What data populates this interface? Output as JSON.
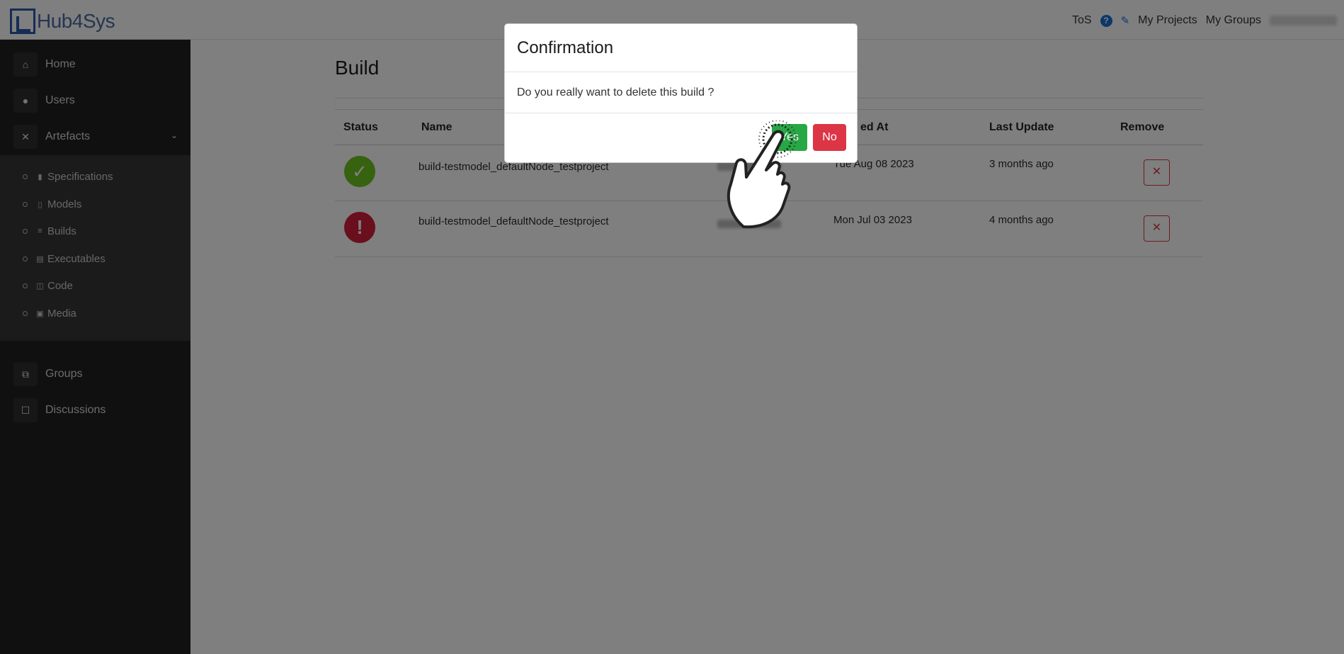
{
  "brand": {
    "name": "Hub4Sys"
  },
  "topnav": {
    "tos": "ToS",
    "help_icon": "help-icon",
    "feedback_icon": "feedback-icon",
    "my_projects": "My Projects",
    "my_groups": "My Groups"
  },
  "sidebar": {
    "items": [
      {
        "label": "Home",
        "icon": "home-icon"
      },
      {
        "label": "Users",
        "icon": "user-icon"
      },
      {
        "label": "Artefacts",
        "icon": "tools-icon"
      }
    ],
    "sub_items": [
      {
        "label": "Specifications",
        "icon": "book-icon"
      },
      {
        "label": "Models",
        "icon": "file-icon"
      },
      {
        "label": "Builds",
        "icon": "database-icon"
      },
      {
        "label": "Executables",
        "icon": "file-text-icon"
      },
      {
        "label": "Code",
        "icon": "code-icon"
      },
      {
        "label": "Media",
        "icon": "images-icon"
      }
    ],
    "bottom_items": [
      {
        "label": "Groups",
        "icon": "groups-icon"
      },
      {
        "label": "Discussions",
        "icon": "chat-icon"
      }
    ]
  },
  "main": {
    "title": "Build",
    "columns": [
      "Status",
      "Name",
      "ed At",
      "Last Update",
      "Remove"
    ],
    "rows": [
      {
        "status": "success",
        "name": "build-testmodel_defaultNode_testproject",
        "created": "Tue Aug 08 2023",
        "updated": "3 months ago"
      },
      {
        "status": "error",
        "name": "build-testmodel_defaultNode_testproject",
        "created": "Mon Jul 03 2023",
        "updated": "4 months ago"
      }
    ]
  },
  "modal": {
    "title": "Confirmation",
    "body": "Do you really want to delete this build ?",
    "yes_label": "Yes",
    "no_label": "No"
  },
  "colors": {
    "success": "#6fc41e",
    "danger": "#dc3545",
    "yes": "#28a745",
    "sidebar": "#202020",
    "brand": "#2a5ba8"
  }
}
